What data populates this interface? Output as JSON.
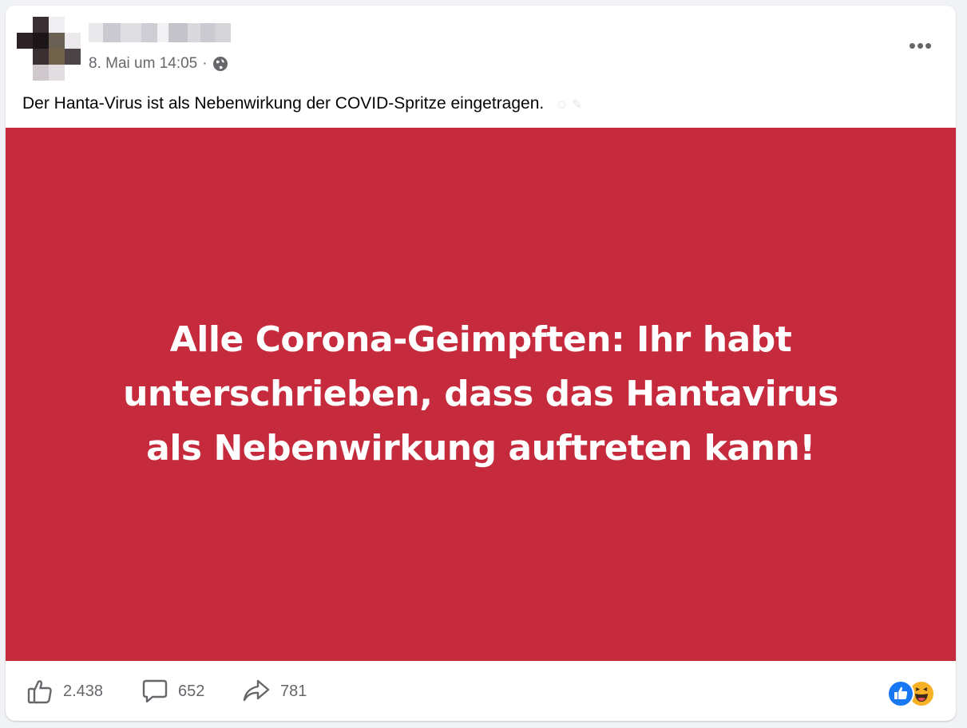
{
  "post": {
    "timestamp": "8. Mai um 14:05",
    "separator": "·",
    "privacy_icon": "globe-icon",
    "more_label": "•••",
    "text": "Der Hanta-Virus ist als Nebenwirkung der COVID-Spritze eingetragen.",
    "media_text": "Alle Corona-Geimpften: Ihr habt unterschrieben, dass das Hantavirus als Nebenwirkung auftreten kann!"
  },
  "stats": {
    "likes": "2.438",
    "comments": "652",
    "shares": "781"
  },
  "icons": {
    "like": "thumbs-up-icon",
    "comment": "comment-icon",
    "share": "share-icon",
    "reaction_like": "like-reaction-icon",
    "reaction_haha": "haha-reaction-icon"
  },
  "colors": {
    "media_background": "#c62b3d",
    "like_blue": "#1877f2",
    "haha_yellow": "#f7b125",
    "secondary_text": "#65676b"
  }
}
